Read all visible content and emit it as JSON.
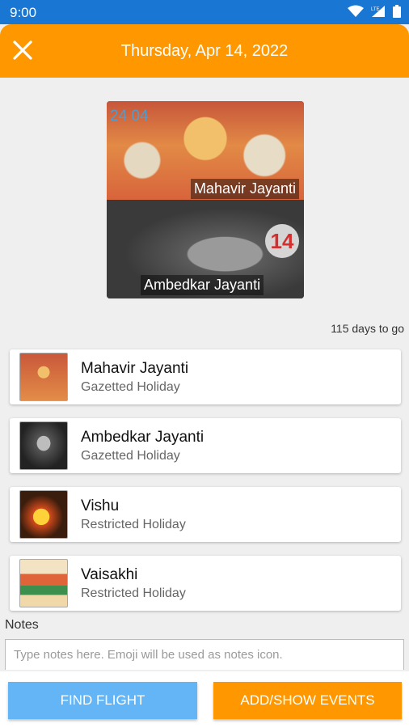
{
  "status_bar": {
    "time": "9:00",
    "icons": [
      "wifi-icon",
      "lte-signal-icon",
      "battery-icon"
    ],
    "color": "#1976d2"
  },
  "app_bar": {
    "title": "Thursday, Apr 14, 2022",
    "color": "#ff9800",
    "close_icon": "close-icon"
  },
  "hero": {
    "date_overlay": "24 04",
    "top_caption": "Mahavir Jayanti",
    "bottom_caption": "Ambedkar Jayanti",
    "day_number": "14"
  },
  "days_to_go": "115 days to go",
  "events": [
    {
      "name": "Mahavir Jayanti",
      "type": "Gazetted Holiday",
      "thumb": "mahavir-jayanti-thumbnail"
    },
    {
      "name": "Ambedkar Jayanti",
      "type": "Gazetted Holiday",
      "thumb": "ambedkar-jayanti-thumbnail"
    },
    {
      "name": "Vishu",
      "type": "Restricted Holiday",
      "thumb": "vishu-thumbnail"
    },
    {
      "name": "Vaisakhi",
      "type": "Restricted Holiday",
      "thumb": "vaisakhi-thumbnail"
    }
  ],
  "notes": {
    "label": "Notes",
    "placeholder": "Type notes here. Emoji will be used as notes icon."
  },
  "buttons": {
    "find_flight": "FIND FLIGHT",
    "add_show_events": "ADD/SHOW EVENTS"
  }
}
